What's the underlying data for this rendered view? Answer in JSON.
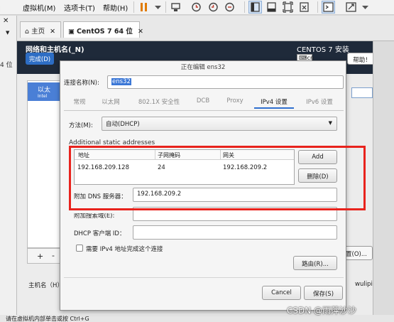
{
  "vmware": {
    "menu": [
      "虚拟机(M)",
      "选项卡(T)",
      "帮助(H)"
    ],
    "tabs": [
      {
        "label": "主页"
      },
      {
        "label": "CentOS 7 64 位"
      }
    ],
    "left_partial": "4 位"
  },
  "anaconda": {
    "section_title": "网络和主机名(_N)",
    "done_button": "完成(D)",
    "install_title": "CENTOS 7 安装",
    "lang_code": "cn",
    "help_button": "帮助！",
    "iface_label": "以太",
    "iface_sub": "Intel",
    "hostname_label": "主机名（H）",
    "hostname_value": "wuliping",
    "config_button_partial": "置(O)...",
    "add_symbol": "+",
    "remove_symbol": "-",
    "status_bar": "请在虚拟机内部单击或按 Ctrl+G"
  },
  "dialog": {
    "title": "正在编辑 ens32",
    "conn_name_label": "连接名称(N):",
    "conn_name_value": "ens32",
    "tabs": [
      "常规",
      "以太网",
      "802.1X 安全性",
      "DCB",
      "Proxy",
      "IPv4 设置",
      "IPv6 设置"
    ],
    "active_tab": "IPv4 设置",
    "method_label": "方法(M):",
    "method_value": "自动(DHCP)",
    "section_title": "Additional static addresses",
    "table": {
      "headers": [
        "地址",
        "子网掩码",
        "网关"
      ],
      "rows": [
        [
          "192.168.209.128",
          "24",
          "192.168.209.2"
        ]
      ]
    },
    "add_button": "Add",
    "delete_button": "删除(D)",
    "dns_label": "附加 DNS 服务器：",
    "dns_value": "192.168.209.2",
    "search_domain_label": "附加搜索域(E):",
    "dhcp_id_label": "DHCP 客户端 ID：",
    "require_ipv4_label": "需要 IPv4 地址完成这个连接",
    "routes_button": "路由(R)...",
    "cancel_button": "Cancel",
    "save_button": "保存(S)"
  },
  "watermark": "CSDN @雨萍沙沙",
  "colors": {
    "anaconda_header": "#1f2a3a",
    "done_button": "#2d6dc4",
    "highlight_box": "#e8231d",
    "tab_underline": "#2f6fcf"
  }
}
